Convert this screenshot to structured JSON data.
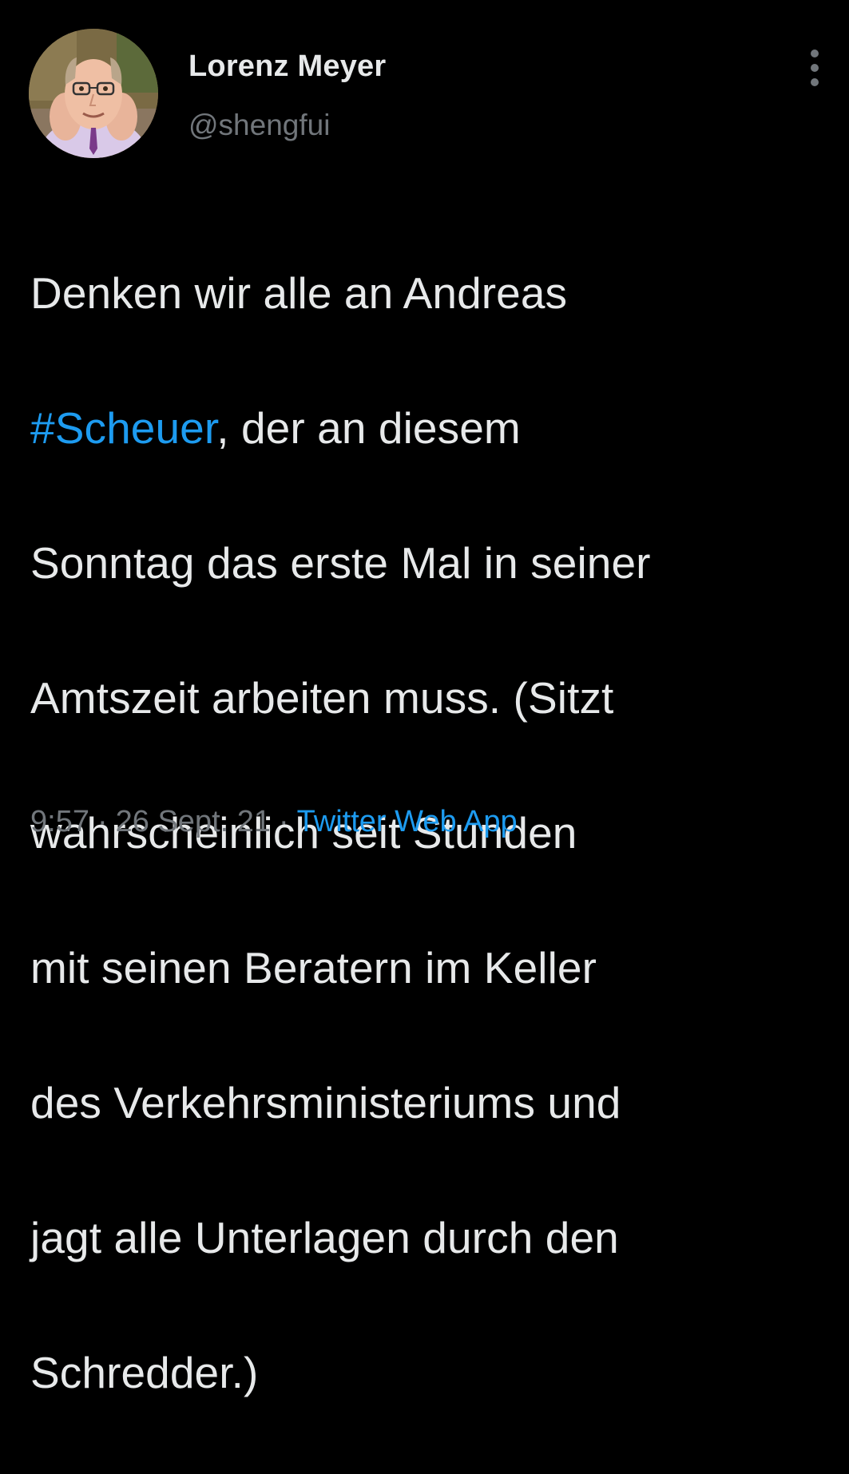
{
  "author": {
    "display_name": "Lorenz Meyer",
    "handle": "@shengfui",
    "avatar_icon": "profile-photo"
  },
  "menu": {
    "icon": "more-vertical-icon"
  },
  "tweet": {
    "lines": [
      {
        "before": "Denken wir alle an Andreas",
        "hashtag": "",
        "after": ""
      },
      {
        "before": "",
        "hashtag": "#Scheuer",
        "after": ", der an diesem"
      },
      {
        "before": "Sonntag das erste Mal in seiner",
        "hashtag": "",
        "after": ""
      },
      {
        "before": "Amtszeit arbeiten muss. (Sitzt",
        "hashtag": "",
        "after": ""
      },
      {
        "before": "wahrscheinlich seit Stunden",
        "hashtag": "",
        "after": ""
      },
      {
        "before": "mit seinen Beratern im Keller",
        "hashtag": "",
        "after": ""
      },
      {
        "before": "des Verkehrsministeriums und",
        "hashtag": "",
        "after": ""
      },
      {
        "before": "jagt alle Unterlagen durch den",
        "hashtag": "",
        "after": ""
      },
      {
        "before": "Schredder.)",
        "hashtag": "",
        "after": ""
      }
    ]
  },
  "meta": {
    "time": "9:57",
    "separator": "·",
    "date": "26 Sept. 21",
    "source": "Twitter Web App"
  },
  "colors": {
    "background": "#000000",
    "text": "#e7e9ea",
    "secondary": "#71767b",
    "accent": "#1d9bf0"
  }
}
